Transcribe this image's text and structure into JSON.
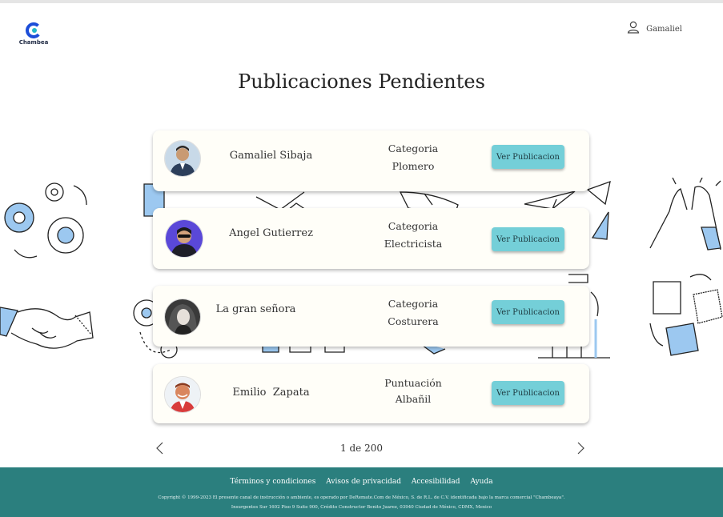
{
  "brand": {
    "name": "Chambea",
    "accent": "#1d4ed8"
  },
  "user": {
    "name": "Gamaliel",
    "icon": "user-icon"
  },
  "page": {
    "title": "Publicaciones Pendientes"
  },
  "cards": [
    {
      "name": "Gamaliel Sibaja",
      "cat_label": "Categoria",
      "cat_value": "Plomero",
      "button": "Ver Publicacion",
      "avatar": "avatar-man-suit"
    },
    {
      "name": "Angel Gutierrez",
      "cat_label": "Categoria",
      "cat_value": "Electricista",
      "button": "Ver Publicacion",
      "avatar": "avatar-man-sunglasses"
    },
    {
      "name": "La gran señora",
      "cat_label": "Categoria",
      "cat_value": "Costurera",
      "button": "Ver Publicacion",
      "avatar": "avatar-woman"
    },
    {
      "name": "Emilio  Zapata",
      "cat_label": "Puntuación",
      "cat_value": "Albañil",
      "button": "Ver Publicacion",
      "avatar": "avatar-man-smiling"
    }
  ],
  "pagination": {
    "text": "1 de 200",
    "prev_icon": "chevron-left-icon",
    "next_icon": "chevron-right-icon"
  },
  "footer": {
    "links": [
      "Términos y condiciones",
      "Avisos de privacidad",
      "Accesibilidad",
      "Ayuda"
    ],
    "copyright": "Copyright © 1999-2023 El presente canal de instrucción o ambiente, es operado por DeRemate.Com de México, S. de R.L. de C.V. identificada bajo la marca comercial \"Chambeaya\".",
    "address": "Insurgentes Sur 1602 Piso 9 Suite 900, Crédito Constructor Benito Juarez, 03940 Ciudad de México, CDMX, Mexico",
    "color": "#2b7f7e"
  },
  "colors": {
    "button": "#74cfd8",
    "card": "#fffef8",
    "deco_blue": "#9cc8f0"
  }
}
